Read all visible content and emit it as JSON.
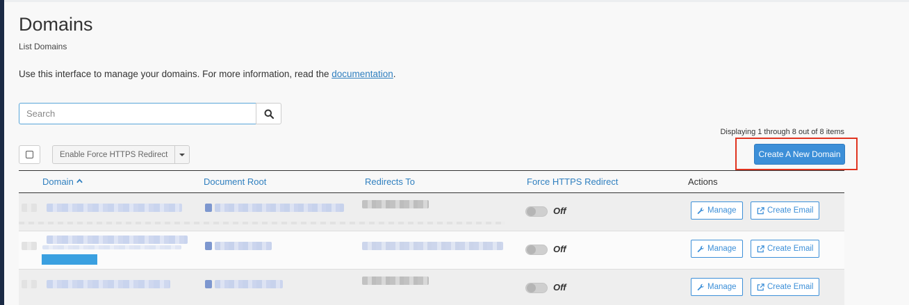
{
  "page": {
    "title": "Domains",
    "subtitle": "List Domains",
    "intro_text": "Use this interface to manage your domains. For more information, read the",
    "intro_link": "documentation",
    "intro_end": "."
  },
  "search": {
    "placeholder": "Search",
    "button_icon": "search-icon"
  },
  "pagination": {
    "summary": "Displaying 1 through 8 out of 8 items"
  },
  "toolbar": {
    "bulk_action_label": "Enable Force HTTPS Redirect",
    "create_label": "Create A New Domain"
  },
  "table": {
    "columns": {
      "domain": "Domain",
      "document_root": "Document Root",
      "redirects_to": "Redirects To",
      "force_https": "Force HTTPS Redirect",
      "actions": "Actions"
    },
    "rows": [
      {
        "force_https_state": "Off",
        "manage_label": "Manage",
        "email_label": "Create Email"
      },
      {
        "force_https_state": "Off",
        "manage_label": "Manage",
        "email_label": "Create Email"
      },
      {
        "force_https_state": "Off",
        "manage_label": "Manage",
        "email_label": "Create Email"
      }
    ]
  },
  "colors": {
    "accent": "#3c8fd8",
    "highlight": "#e0331f",
    "link": "#2f7fbf"
  }
}
